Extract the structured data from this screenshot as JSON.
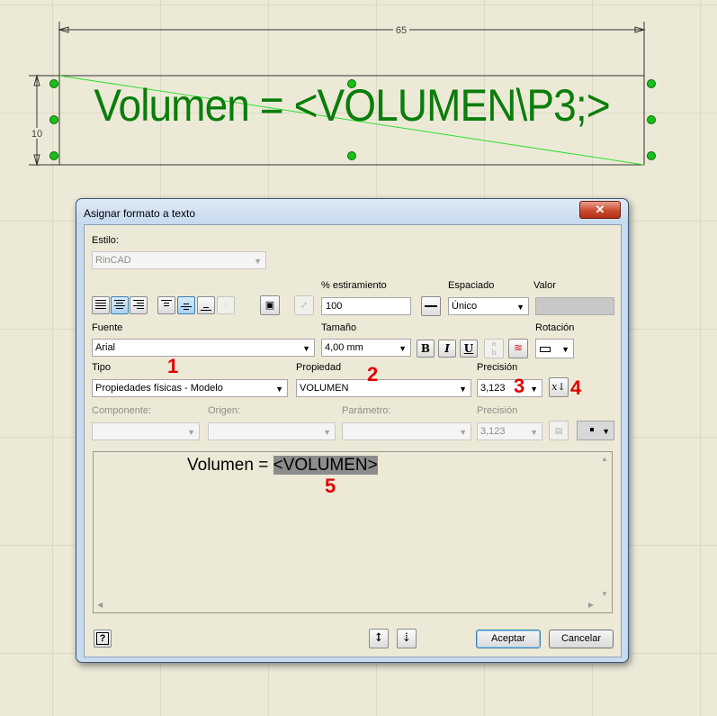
{
  "drawing": {
    "dimension_width": "65",
    "dimension_height": "10",
    "text": "Volumen = <VOLUMEN\\P3;>"
  },
  "dialog": {
    "title": "Asignar formato a texto",
    "estilo_label": "Estilo:",
    "estilo_value": "RinCAD",
    "estiramiento_label": "% estiramiento",
    "estiramiento_value": "100",
    "espaciado_label": "Espaciado",
    "espaciado_value": "Único",
    "valor_label": "Valor",
    "fuente_label": "Fuente",
    "fuente_value": "Arial",
    "tamano_label": "Tamaño",
    "tamano_value": "4,00 mm",
    "rotacion_label": "Rotación",
    "tipo_label": "Tipo",
    "tipo_value": "Propiedades físicas - Modelo",
    "propiedad_label": "Propiedad",
    "propiedad_value": "VOLUMEN",
    "precision_label": "Precisión",
    "precision_value": "3,123",
    "componente_label": "Componente:",
    "origen_label": "Origen:",
    "parametro_label": "Parámetro:",
    "precision2_label": "Precisión",
    "precision2_value": "3,123",
    "editor_text": "Volumen = ",
    "editor_token": "<VOLUMEN>",
    "bold_label": "B",
    "italic_label": "I",
    "underline_label": "U",
    "help_label": "?",
    "accept_label": "Aceptar",
    "cancel_label": "Cancelar"
  },
  "annotations": [
    "1",
    "2",
    "3",
    "4",
    "5"
  ],
  "colors": {
    "canvas": "#ecead7",
    "drawing_text": "#0a7d0a",
    "annotation": "#e30000",
    "dialog_frame": "#c9dcef"
  }
}
